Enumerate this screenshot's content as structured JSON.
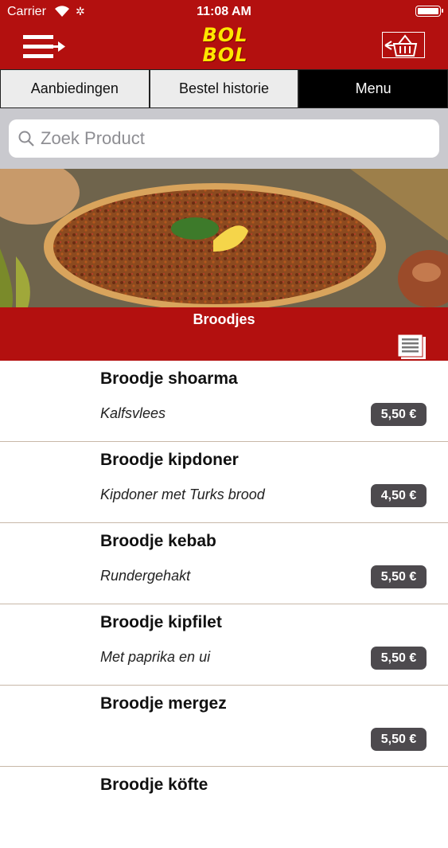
{
  "status_bar": {
    "carrier": "Carrier",
    "time": "11:08 AM"
  },
  "header": {
    "logo_line1": "BOL",
    "logo_line2": "BOL",
    "menu_icon": "menu-arrow-icon",
    "cart_icon": "shopping-basket-icon"
  },
  "tabs": [
    {
      "label": "Aanbiedingen",
      "active": false
    },
    {
      "label": "Bestel historie",
      "active": false
    },
    {
      "label": "Menu",
      "active": true
    }
  ],
  "search": {
    "placeholder": "Zoek Product"
  },
  "category": {
    "title": "Broodjes",
    "list_icon": "document-list-icon"
  },
  "products": [
    {
      "name": "Broodje shoarma",
      "description": "Kalfsvlees",
      "price": "5,50 €"
    },
    {
      "name": "Broodje kipdoner",
      "description": "Kipdoner met Turks brood",
      "price": "4,50 €"
    },
    {
      "name": "Broodje kebab",
      "description": "Rundergehakt",
      "price": "5,50 €"
    },
    {
      "name": "Broodje kipfilet",
      "description": "Met paprika en ui",
      "price": "5,50 €"
    },
    {
      "name": "Broodje mergez",
      "description": "",
      "price": "5,50 €"
    },
    {
      "name": "Broodje köfte",
      "description": "",
      "price": ""
    }
  ],
  "colors": {
    "brand_red": "#b3100f",
    "logo_yellow": "#ffe600",
    "price_badge": "#4d4a4e"
  }
}
